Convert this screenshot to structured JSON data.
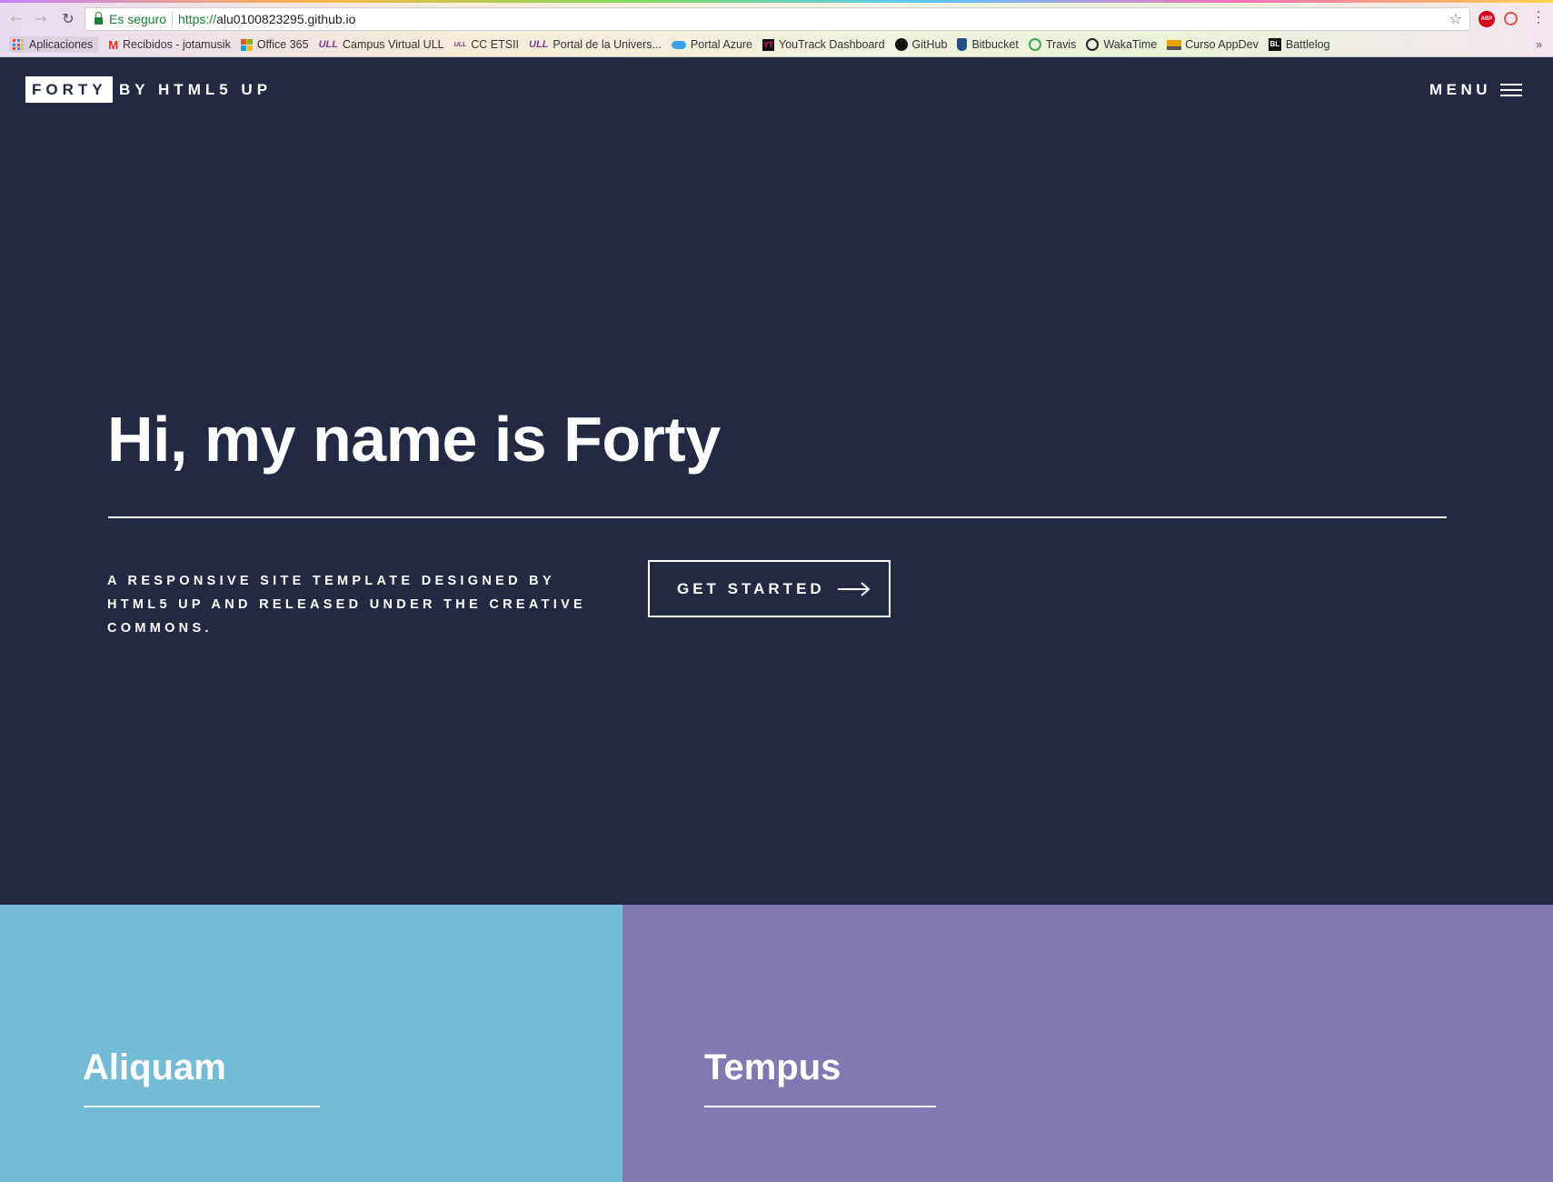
{
  "browser": {
    "secure_label": "Es seguro",
    "url_scheme": "https://",
    "url_host": "alu0100823295.github.io",
    "abp_label": "ABP",
    "bookmarks": [
      {
        "label": "Aplicaciones",
        "icon": "apps-grid-icon"
      },
      {
        "label": "Recibidos - jotamusik",
        "icon": "gmail-icon"
      },
      {
        "label": "Office 365",
        "icon": "office-icon"
      },
      {
        "label": "Campus Virtual ULL",
        "icon": "ull-icon"
      },
      {
        "label": "CC ETSII",
        "icon": "ull-icon"
      },
      {
        "label": "Portal de la Univers...",
        "icon": "ull-icon"
      },
      {
        "label": "Portal Azure",
        "icon": "azure-cloud-icon"
      },
      {
        "label": "YouTrack Dashboard",
        "icon": "youtrack-icon"
      },
      {
        "label": "GitHub",
        "icon": "github-icon"
      },
      {
        "label": "Bitbucket",
        "icon": "bitbucket-icon"
      },
      {
        "label": "Travis",
        "icon": "travis-icon"
      },
      {
        "label": "WakaTime",
        "icon": "wakatime-icon"
      },
      {
        "label": "Curso AppDev",
        "icon": "folder-icon"
      },
      {
        "label": "Battlelog",
        "icon": "battlelog-icon"
      }
    ],
    "ull_glyph": "ULL",
    "yt_glyph": "YT",
    "bl_glyph": "BL"
  },
  "site": {
    "logo": "FORTY",
    "logo_by": "BY HTML5 UP",
    "menu_label": "MENU",
    "hero_title": "Hi, my name is Forty",
    "hero_subtitle": "A responsive site template designed by HTML5 UP and released under the Creative Commons.",
    "cta_label": "GET STARTED",
    "tiles": [
      {
        "title": "Aliquam",
        "color": "#74bcd5"
      },
      {
        "title": "Tempus",
        "color": "#8279b3"
      }
    ],
    "colors": {
      "background": "#242943",
      "accent_text": "#ffffff"
    }
  }
}
